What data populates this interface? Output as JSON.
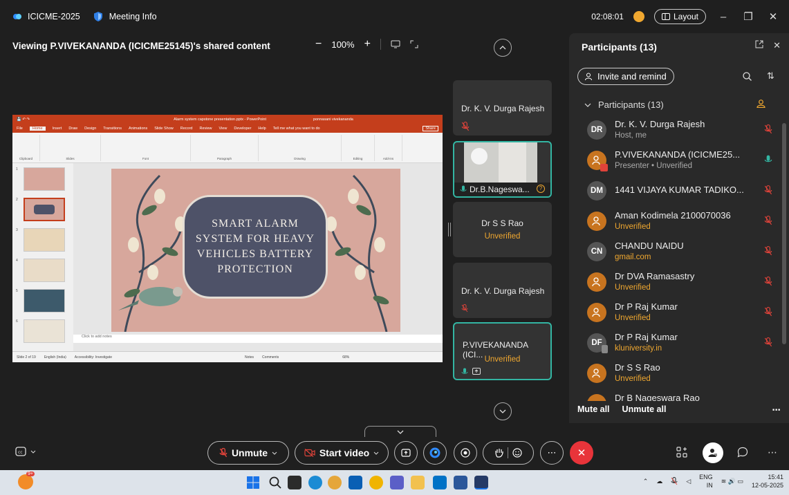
{
  "titlebar": {
    "app_name": "ICICME-2025",
    "meeting_info": "Meeting Info",
    "timer": "02:08:01",
    "layout_label": "Layout"
  },
  "share": {
    "viewing_text": "Viewing P.VIVEKANANDA (ICICME25145)'s shared content",
    "zoom_level": "100%"
  },
  "ppt": {
    "window_title": "Alarm system capstone presentation.pptx - PowerPoint",
    "user": "ponnasani vivekananda",
    "tabs": [
      "File",
      "Home",
      "Insert",
      "Draw",
      "Design",
      "Transitions",
      "Animations",
      "Slide Show",
      "Record",
      "Review",
      "View",
      "Developer",
      "Help",
      "Tell me what you want to do"
    ],
    "share_label": "Share",
    "ribbon_groups": [
      "Clipboard",
      "Slides",
      "Font",
      "Paragraph",
      "Drawing",
      "Editing",
      "Add-ins"
    ],
    "slide_lines": [
      "SMART ALARM",
      "SYSTEM FOR HEAVY",
      "VEHICLES BATTERY",
      "PROTECTION"
    ],
    "thumb_numbers": [
      "1",
      "2",
      "3",
      "4",
      "5",
      "6"
    ],
    "notes_placeholder": "Click to add notes",
    "status_slide": "Slide 2 of 19",
    "status_lang": "English (India)",
    "status_access": "Accessibility: Investigate",
    "status_notes": "Notes",
    "status_comments": "Comments",
    "status_zoom": "68%"
  },
  "tiles": [
    {
      "name": "Dr. K. V. Durga Rajesh",
      "sub": ""
    },
    {
      "name": "Dr.B.Nageswa...",
      "sub": ""
    },
    {
      "name": "Dr S S Rao",
      "sub": "Unverified"
    },
    {
      "name": "Dr. K. V. Durga Rajesh",
      "sub": ""
    },
    {
      "name": "P.VIVEKANANDA (ICI...",
      "sub": "Unverified"
    }
  ],
  "panel": {
    "title": "Participants (13)",
    "invite_label": "Invite and remind",
    "section_label": "Participants (13)",
    "participants": [
      {
        "initials": "DR",
        "name": "Dr. K. V. Durga Rajesh",
        "sub": "Host, me",
        "sub_color": "gray",
        "avatar_color": "#555555",
        "mic": "muted"
      },
      {
        "initials": "",
        "name": "P.VIVEKANANDA (ICICME25...",
        "sub": "Presenter • Unverified",
        "sub_color": "mixed",
        "avatar_color": "#c8741f",
        "mic": "on"
      },
      {
        "initials": "DM",
        "name": "1441 VIJAYA KUMAR TADIKO...",
        "sub": "",
        "sub_color": "gray",
        "avatar_color": "#555555",
        "mic": "muted"
      },
      {
        "initials": "",
        "name": "Aman Kodimela 2100070036",
        "sub": "Unverified",
        "sub_color": "orange",
        "avatar_color": "#c8741f",
        "mic": "muted"
      },
      {
        "initials": "CN",
        "name": "CHANDU NAIDU",
        "sub": "gmail.com",
        "sub_color": "orange",
        "avatar_color": "#555555",
        "mic": "muted"
      },
      {
        "initials": "",
        "name": "Dr DVA Ramasastry",
        "sub": "Unverified",
        "sub_color": "orange",
        "avatar_color": "#c8741f",
        "mic": "muted"
      },
      {
        "initials": "",
        "name": "Dr P Raj Kumar",
        "sub": "Unverified",
        "sub_color": "orange",
        "avatar_color": "#c8741f",
        "mic": "muted"
      },
      {
        "initials": "DF",
        "name": "Dr P Raj Kumar",
        "sub": "kluniversity.in",
        "sub_color": "orange",
        "avatar_color": "#555555",
        "mic": "muted"
      },
      {
        "initials": "",
        "name": "Dr S S Rao",
        "sub": "Unverified",
        "sub_color": "orange",
        "avatar_color": "#c8741f",
        "mic": "none"
      },
      {
        "initials": "",
        "name": "Dr B Nageswara Rao",
        "sub": "",
        "sub_color": "gray",
        "avatar_color": "#c8741f",
        "mic": "none"
      }
    ],
    "mute_all": "Mute all",
    "unmute_all": "Unmute all"
  },
  "controls": {
    "unmute_label": "Unmute",
    "start_video_label": "Start video"
  },
  "taskbar": {
    "badge": "9+",
    "lang": "ENG",
    "region": "IN",
    "time": "15:41",
    "date": "12-05-2025"
  },
  "colors": {
    "accent_teal": "#33b6a3",
    "unverified_orange": "#f0a830",
    "muted_red": "#e0433a",
    "leave_red": "#e8343a",
    "ppt_red": "#c43e1c"
  }
}
